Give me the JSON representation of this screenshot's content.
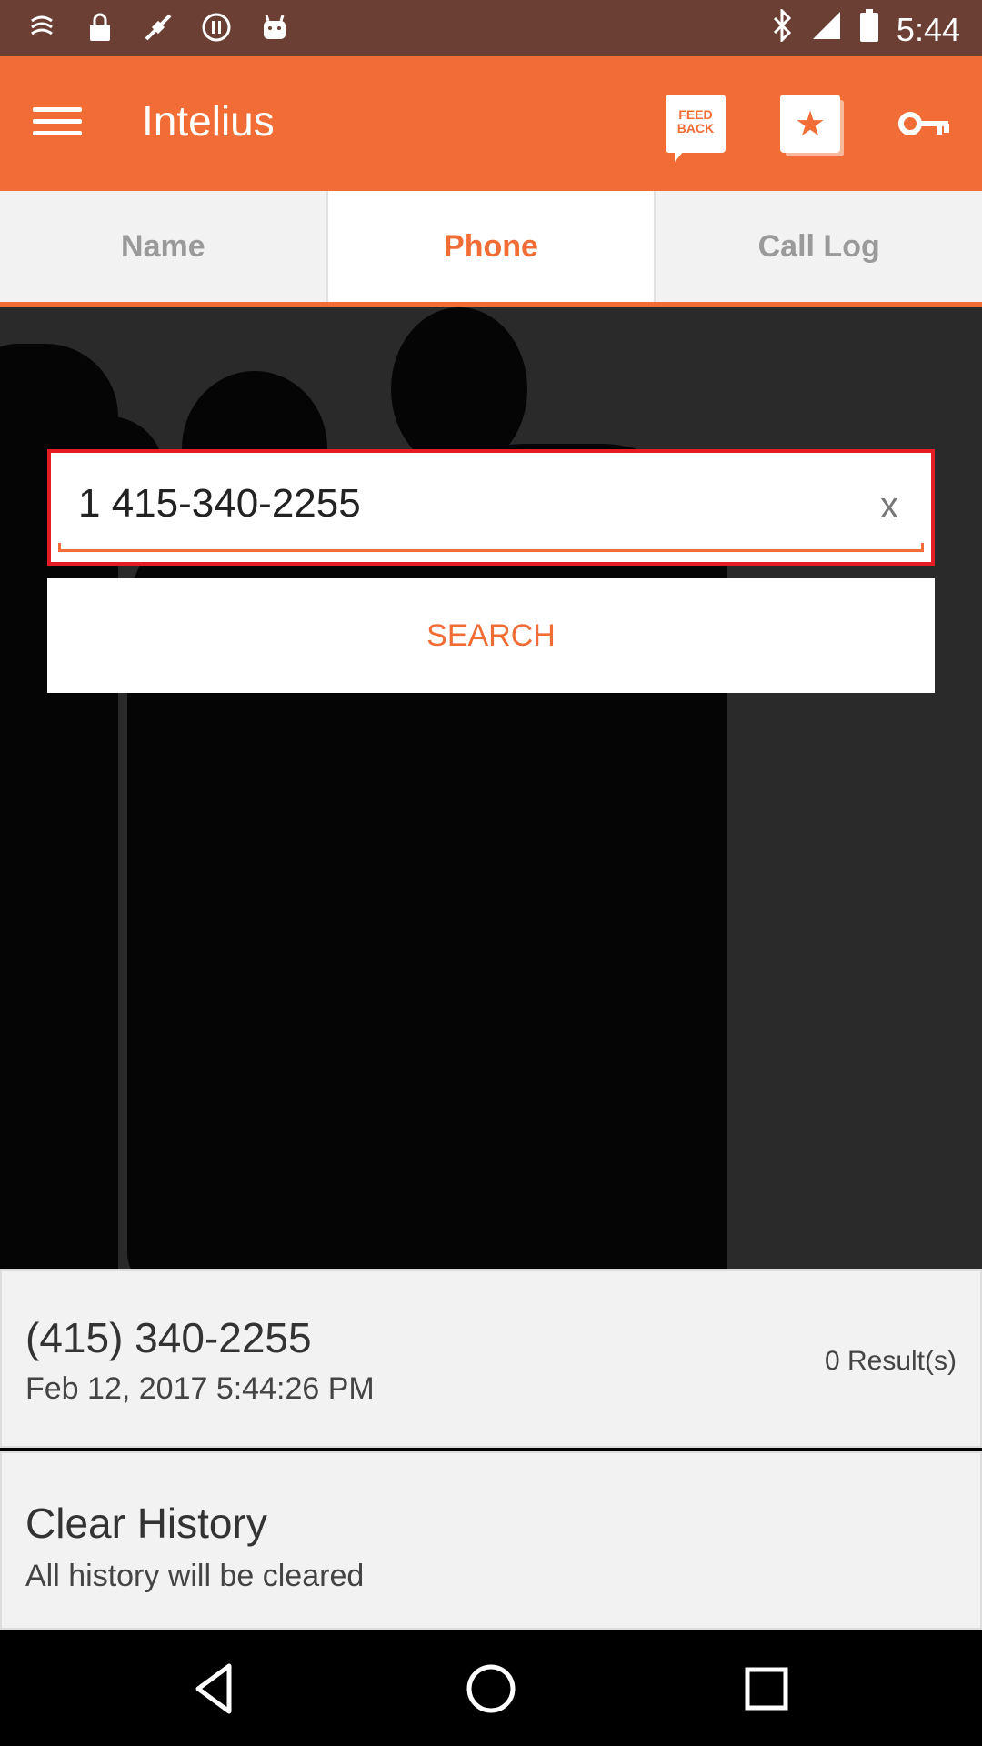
{
  "status_bar": {
    "time": "5:44",
    "left_icons": [
      "notification-icon",
      "lock-icon",
      "fake-gps-icon",
      "pause-icon",
      "android-icon"
    ],
    "right_icons": [
      "bluetooth-icon",
      "signal-icon",
      "battery-icon"
    ]
  },
  "app_bar": {
    "title": "Intelius",
    "feedback_label": "FEED BACK",
    "icons": [
      "menu-icon",
      "feedback-icon",
      "star-icon",
      "key-icon"
    ],
    "accent_color": "#f26d35"
  },
  "tabs": [
    {
      "label": "Name",
      "active": false
    },
    {
      "label": "Phone",
      "active": true
    },
    {
      "label": "Call Log",
      "active": false
    }
  ],
  "search": {
    "value": "1 415-340-2255",
    "clear_label": "x",
    "button_label": "SEARCH"
  },
  "history": [
    {
      "phone": "(415) 340-2255",
      "date": "Feb 12, 2017 5:44:26 PM",
      "results": "0 Result(s)"
    }
  ],
  "clear_history": {
    "title": "Clear History",
    "subtitle": "All history will be cleared"
  },
  "nav_bar": {
    "icons": [
      "back-icon",
      "home-icon",
      "recents-icon"
    ]
  }
}
